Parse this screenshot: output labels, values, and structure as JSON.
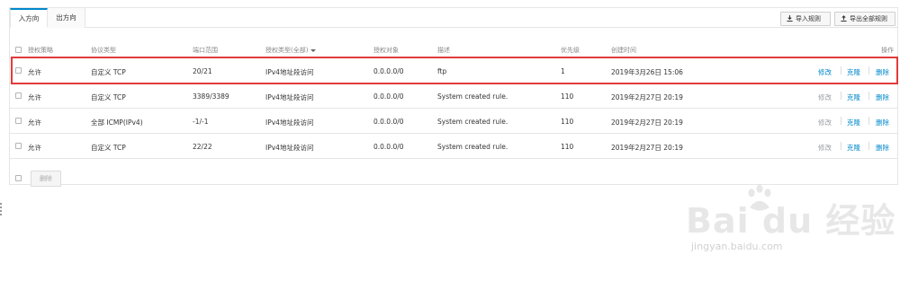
{
  "tabs": [
    {
      "label": "入方向",
      "active": true
    },
    {
      "label": "出方向",
      "active": false
    }
  ],
  "toolbar": {
    "import_label": "导入规则",
    "export_label": "导出全部规则"
  },
  "table": {
    "headers": {
      "policy": "授权策略",
      "protocol": "协议类型",
      "port": "端口范围",
      "auth_type": "授权类型(全部)",
      "target": "授权对象",
      "desc": "描述",
      "priority": "优先级",
      "created": "创建时间",
      "ops": "操作"
    },
    "rows": [
      {
        "policy": "允许",
        "protocol": "自定义 TCP",
        "port": "20/21",
        "auth_type": "IPv4地址段访问",
        "target": "0.0.0.0/0",
        "desc": "ftp",
        "priority": "1",
        "created": "2019年3月26日 15:06",
        "edit": "修改",
        "clone": "克隆",
        "delete": "删除",
        "edit_enabled": true
      },
      {
        "policy": "允许",
        "protocol": "自定义 TCP",
        "port": "3389/3389",
        "auth_type": "IPv4地址段访问",
        "target": "0.0.0.0/0",
        "desc": "System created rule.",
        "priority": "110",
        "created": "2019年2月27日 20:19",
        "edit": "修改",
        "clone": "克隆",
        "delete": "删除",
        "edit_enabled": false
      },
      {
        "policy": "允许",
        "protocol": "全部 ICMP(IPv4)",
        "port": "-1/-1",
        "auth_type": "IPv4地址段访问",
        "target": "0.0.0.0/0",
        "desc": "System created rule.",
        "priority": "110",
        "created": "2019年2月27日 20:19",
        "edit": "修改",
        "clone": "克隆",
        "delete": "删除",
        "edit_enabled": false
      },
      {
        "policy": "允许",
        "protocol": "自定义 TCP",
        "port": "22/22",
        "auth_type": "IPv4地址段访问",
        "target": "0.0.0.0/0",
        "desc": "System created rule.",
        "priority": "110",
        "created": "2019年2月27日 20:19",
        "edit": "修改",
        "clone": "克隆",
        "delete": "删除",
        "edit_enabled": false
      }
    ]
  },
  "footer": {
    "delete_label": "删除"
  },
  "watermark": {
    "logo": "Bai du 经验",
    "url": "jingyan.baidu.com"
  },
  "colors": {
    "accent": "#0088cc",
    "highlight": "#e23b3b"
  }
}
